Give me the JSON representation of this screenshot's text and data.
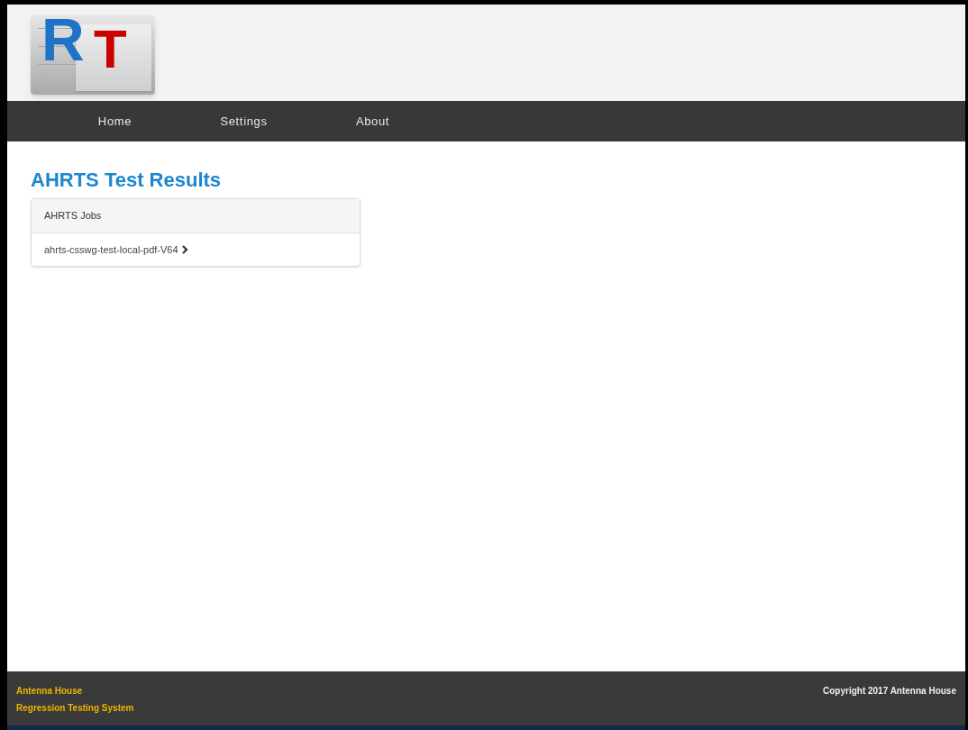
{
  "logo": {
    "letters": [
      "R",
      "T"
    ]
  },
  "nav": [
    {
      "label": "Home"
    },
    {
      "label": "Settings"
    },
    {
      "label": "About"
    }
  ],
  "page_title": "AHRTS Test Results",
  "jobs_panel": {
    "heading": "AHRTS Jobs",
    "items": [
      "ahrts-csswg-test-local-pdf-V64"
    ]
  },
  "footer": {
    "left": [
      "Antenna House",
      "Regression Testing System"
    ],
    "right": "Copyright 2017 Antenna House"
  }
}
